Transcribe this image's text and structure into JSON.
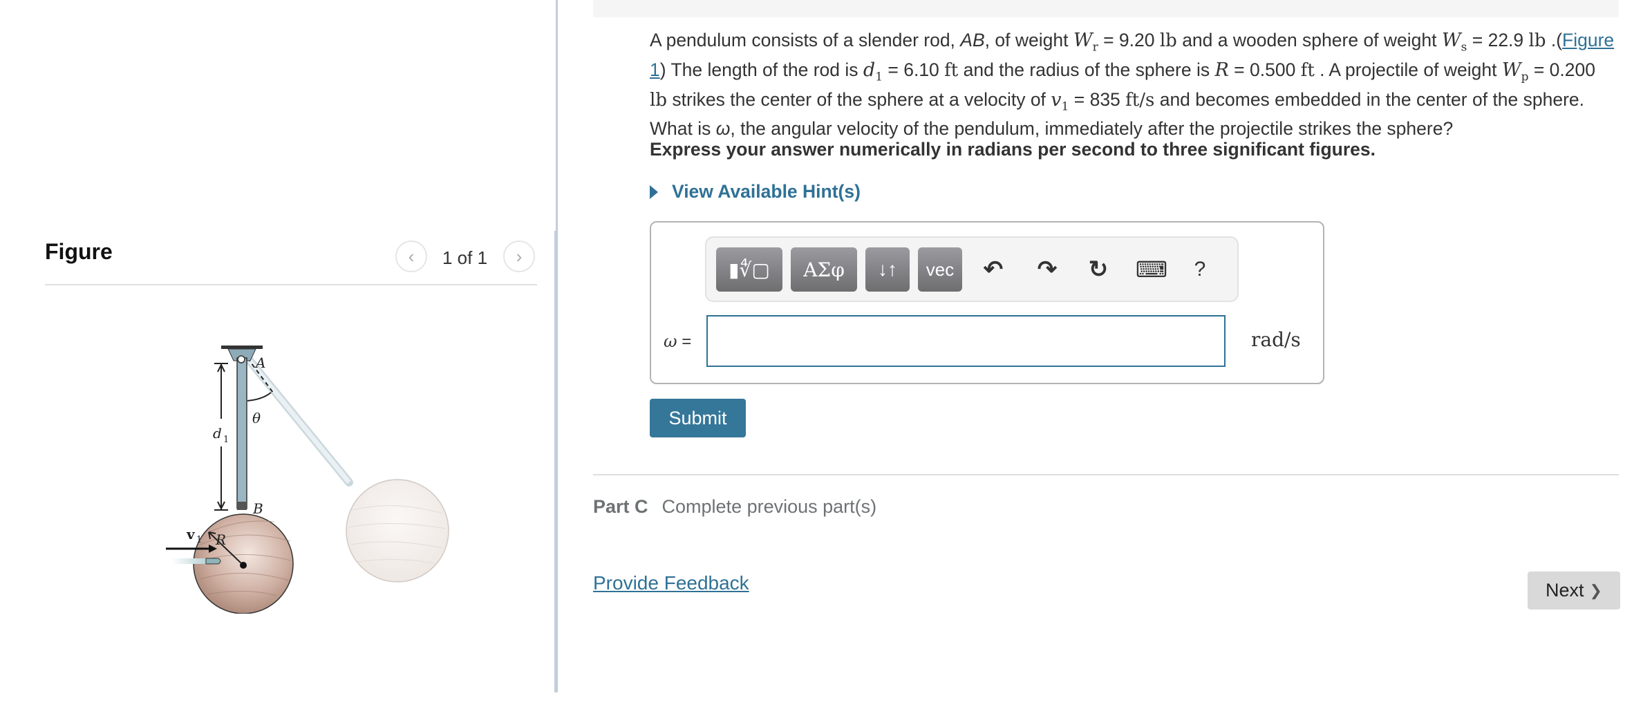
{
  "figure": {
    "title": "Figure",
    "pager": "1 of 1",
    "prev_icon": "‹",
    "next_icon": "›",
    "labels": {
      "A": "A",
      "B": "B",
      "theta": "θ",
      "d1": "d",
      "d1_sub": "1",
      "R": "R",
      "v1": "v",
      "v1_sub": "1"
    }
  },
  "question": {
    "p1": "A pendulum consists of a slender rod, ",
    "rod": "AB",
    "p2": ", of weight ",
    "Wr_sym": "W",
    "Wr_sub": "r",
    "Wr_val": " = 9.20 ",
    "lb1": "lb",
    "p3": " and a wooden sphere of weight ",
    "Ws_sym": "W",
    "Ws_sub": "s",
    "Ws_val": " = 22.9 ",
    "lb2": "lb",
    "p4": " .(",
    "figure_link": "Figure 1",
    "p5": ") The length of the rod is ",
    "d1_sym": "d",
    "d1_sub": "1",
    "d1_val": " = 6.10 ",
    "ft1": "ft",
    "p6": " and the radius of the sphere is ",
    "R_sym": "R",
    "R_val": " = 0.500 ",
    "ft2": "ft",
    "p7": " . A projectile of weight ",
    "Wp_sym": "W",
    "Wp_sub": "p",
    "Wp_val": " = 0.200 ",
    "lb3": "lb",
    "p8": " strikes the center of the sphere at a velocity of ",
    "v1_sym": "v",
    "v1_sub": "1",
    "v1_val": " = 835 ",
    "fts": "ft/s",
    "p9": " and becomes embedded in the center of the sphere. What is ",
    "omega": "ω",
    "p10": ", the angular velocity of the pendulum, immediately after the projectile strikes the sphere?"
  },
  "instructions": "Express your answer numerically in radians per second to three significant figures.",
  "hint_label": "View Available Hint(s)",
  "toolbar": {
    "templates_label": "▮∜▢",
    "greek_label": "ΑΣφ",
    "arrows_label": "↓↑",
    "vec_label": "vec",
    "undo_icon": "↶",
    "redo_icon": "↷",
    "reset_icon": "↻",
    "keyboard_icon": "⌨",
    "help_label": "?"
  },
  "answer": {
    "variable": "ω",
    "equals": "=",
    "value": "",
    "unit": "rad/s"
  },
  "submit_label": "Submit",
  "part_c": {
    "label": "Part C",
    "status": "Complete previous part(s)"
  },
  "feedback_label": "Provide Feedback",
  "next_label": "Next",
  "next_icon": "❯"
}
